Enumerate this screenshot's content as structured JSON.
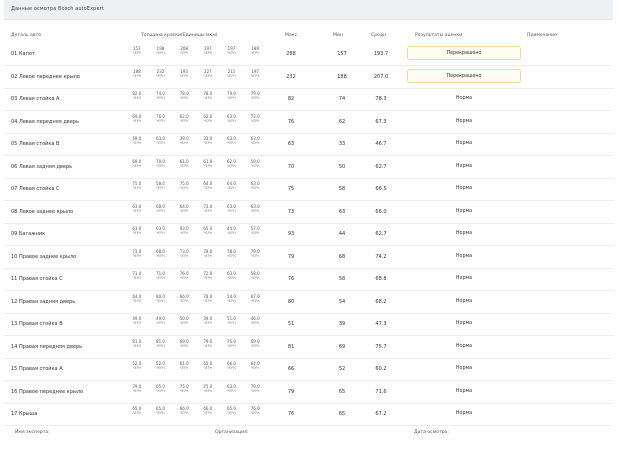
{
  "header": {
    "title": "Данные осмотра Bosch autoExpert"
  },
  "columns": {
    "part": "Деталь авто",
    "thickness": "Толщина краски(Единицы:мкм)",
    "max": "Макс",
    "min": "Мин",
    "avg": "Средн",
    "result": "Результаты оценки",
    "note": "Примечание"
  },
  "unit": "ЧЕРН",
  "rows": [
    {
      "part": "01 Капот",
      "thickness": [
        "157",
        "198",
        "208",
        "197",
        "197",
        "189"
      ],
      "max": "288",
      "min": "157",
      "avg": "193.7",
      "result": "Перекрашено",
      "flag": true
    },
    {
      "part": "02 Левое переднее крыло",
      "thickness": [
        "188",
        "232",
        "193",
        "227",
        "211",
        "197"
      ],
      "max": "232",
      "min": "188",
      "avg": "207.0",
      "result": "Перекрашено",
      "flag": true
    },
    {
      "part": "03 Левая стойка A",
      "thickness": [
        "82.0",
        "74.0",
        "78.0",
        "78.0",
        "79.0",
        "79.0"
      ],
      "max": "82",
      "min": "74",
      "avg": "78.3",
      "result": "Норма",
      "flag": false
    },
    {
      "part": "04 Левая передняя дверь",
      "thickness": [
        "69.0",
        "76.0",
        "62.0",
        "62.0",
        "63.0",
        "72.0"
      ],
      "max": "76",
      "min": "62",
      "avg": "67.3",
      "result": "Норма",
      "flag": false
    },
    {
      "part": "05 Левая стойка B",
      "thickness": [
        "59.0",
        "63.0",
        "39.0",
        "33.0",
        "63.0",
        "63.0"
      ],
      "max": "63",
      "min": "33",
      "avg": "46.7",
      "result": "Норма",
      "flag": false
    },
    {
      "part": "06 Левая задняя дверь",
      "thickness": [
        "69.0",
        "70.0",
        "61.0",
        "61.0",
        "62.0",
        "50.0"
      ],
      "max": "70",
      "min": "50",
      "avg": "62.7",
      "result": "Норма",
      "flag": false
    },
    {
      "part": "07 Левая стойка C",
      "thickness": [
        "75.0",
        "58.0",
        "75.0",
        "64.0",
        "64.0",
        "63.0"
      ],
      "max": "75",
      "min": "58",
      "avg": "66.5",
      "result": "Норма",
      "flag": false
    },
    {
      "part": "08 Левое заднее крыло",
      "thickness": [
        "63.0",
        "68.0",
        "64.0",
        "73.0",
        "63.0",
        "63.0"
      ],
      "max": "73",
      "min": "63",
      "avg": "66.0",
      "result": "Норма",
      "flag": false
    },
    {
      "part": "09 Багажник",
      "thickness": [
        "63.0",
        "63.0",
        "93.0",
        "65.0",
        "44.0",
        "57.0"
      ],
      "max": "93",
      "min": "44",
      "avg": "62.7",
      "result": "Норма",
      "flag": false
    },
    {
      "part": "10 Правое заднее крыло",
      "thickness": [
        "73.0",
        "68.0",
        "73.0",
        "78.0",
        "78.0",
        "79.0"
      ],
      "max": "79",
      "min": "68",
      "avg": "74.2",
      "result": "Норма",
      "flag": false
    },
    {
      "part": "11 Правая стойка C",
      "thickness": [
        "71.0",
        "71.0",
        "76.0",
        "72.0",
        "63.0",
        "58.0"
      ],
      "max": "76",
      "min": "58",
      "avg": "68.8",
      "result": "Норма",
      "flag": false
    },
    {
      "part": "12 Правая задняя дверь",
      "thickness": [
        "64.0",
        "80.0",
        "66.0",
        "78.0",
        "54.0",
        "67.0"
      ],
      "max": "80",
      "min": "54",
      "avg": "68.2",
      "result": "Норма",
      "flag": false
    },
    {
      "part": "13 Правая стойка B",
      "thickness": [
        "49.0",
        "49.0",
        "50.0",
        "39.0",
        "51.0",
        "46.0"
      ],
      "max": "51",
      "min": "39",
      "avg": "47.3",
      "result": "Норма",
      "flag": false
    },
    {
      "part": "14 Правая передняя дверь",
      "thickness": [
        "81.0",
        "81.0",
        "69.0",
        "79.0",
        "75.0",
        "69.0"
      ],
      "max": "81",
      "min": "69",
      "avg": "75.7",
      "result": "Норма",
      "flag": false
    },
    {
      "part": "15 Правая стойка A",
      "thickness": [
        "52.0",
        "52.0",
        "61.0",
        "65.0",
        "66.0",
        "64.0"
      ],
      "max": "66",
      "min": "52",
      "avg": "60.2",
      "result": "Норма",
      "flag": false
    },
    {
      "part": "16 Правое переднее крыло",
      "thickness": [
        "79.0",
        "65.0",
        "75.0",
        "75.0",
        "63.0",
        "79.0"
      ],
      "max": "79",
      "min": "65",
      "avg": "71.6",
      "result": "Норма",
      "flag": false
    },
    {
      "part": "17 Крыша",
      "thickness": [
        "65.0",
        "65.0",
        "66.0",
        "66.0",
        "65.0",
        "76.0"
      ],
      "max": "76",
      "min": "65",
      "avg": "67.2",
      "result": "Норма",
      "flag": false
    }
  ],
  "footer": {
    "expert": "Имя эксперта:",
    "organization": "Организация:",
    "date": "Дата осмотра:"
  }
}
